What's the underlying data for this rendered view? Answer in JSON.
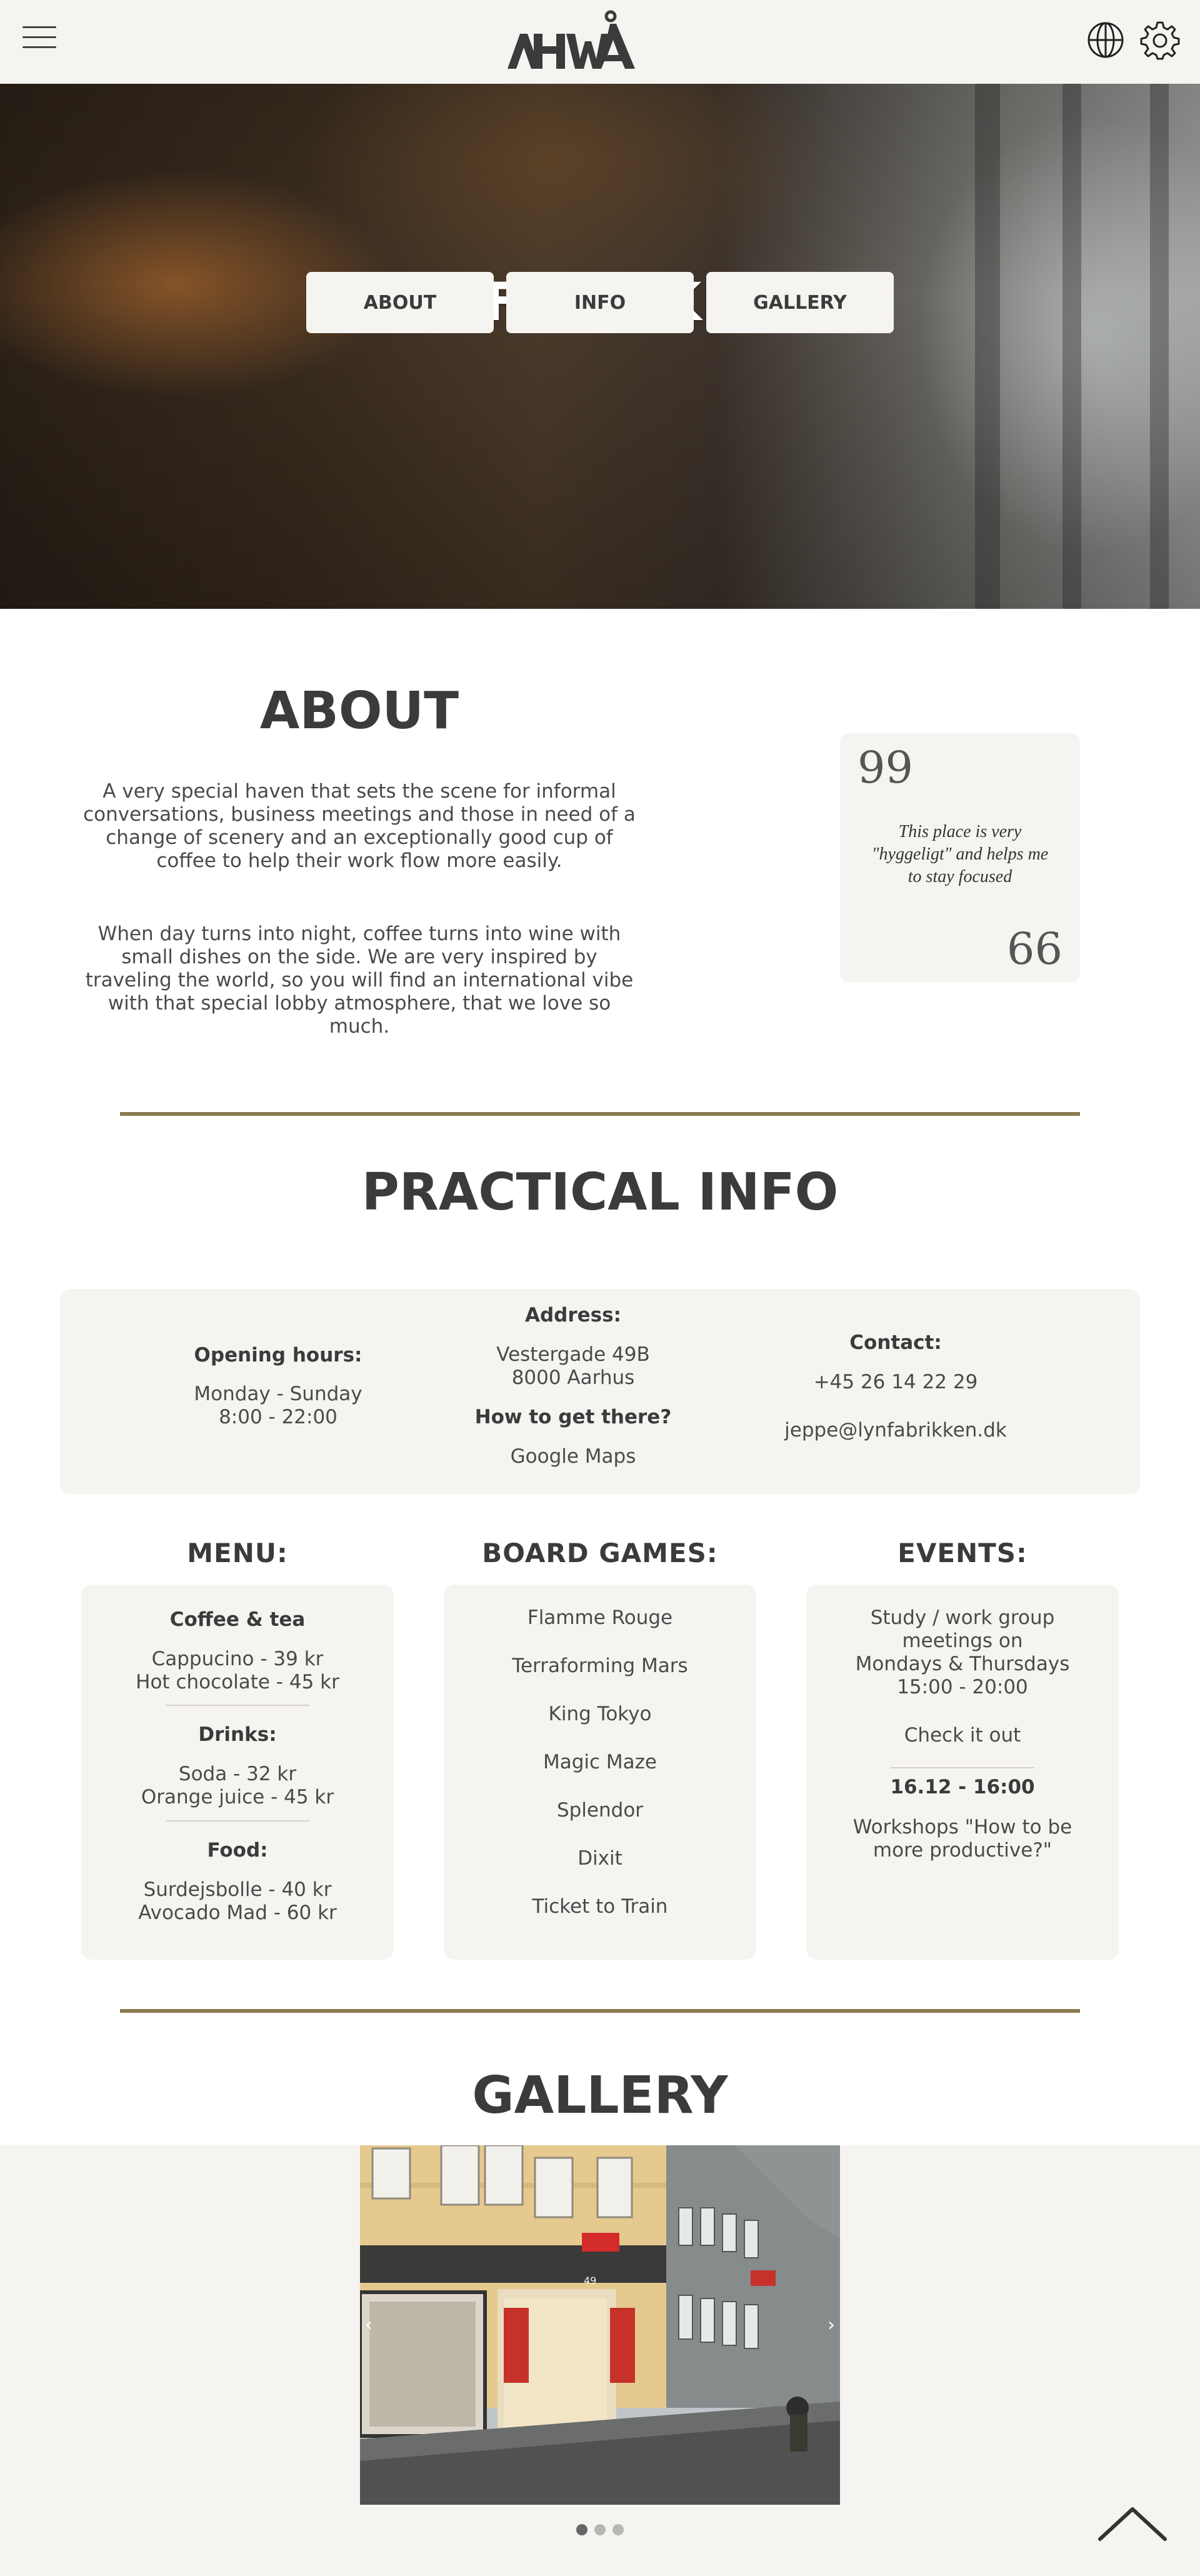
{
  "header": {
    "menu_icon": "hamburger-icon",
    "logo_text": "HWÅ",
    "icons": [
      "globe-icon",
      "gear-icon"
    ]
  },
  "hero": {
    "title": "LYNFABRIKKEN",
    "nav": [
      "ABOUT",
      "INFO",
      "GALLERY"
    ]
  },
  "about": {
    "title": "ABOUT",
    "paragraph1": "A very special haven that sets the scene for informal conversations, business meetings and those in need of a change of scenery and an exceptionally good cup of coffee to help their work flow more easily.",
    "paragraph2": "When day turns into night, coffee turns into wine with small dishes on the side. We are very inspired by traveling the world, so you will find an international vibe with that special lobby atmosphere, that we love so much.",
    "quote": {
      "open_mark": "99",
      "close_mark": "66",
      "text": "This place is very \"hyggeligt\" and helps me to stay focused"
    }
  },
  "practical_info": {
    "title": "PRACTICAL INFO",
    "opening_hours_label": "Opening hours:",
    "opening_days": "Monday - Sunday",
    "opening_time": "8:00 - 22:00",
    "address_label": "Address:",
    "address_line1": "Vestergade 49B",
    "address_line2": "8000 Aarhus",
    "directions_label": "How to get there?",
    "directions_link": "Google Maps",
    "contact_label": "Contact:",
    "phone": "+45 26 14 22 29",
    "email": "jeppe@lynfabrikken.dk"
  },
  "menu": {
    "heading": "MENU:",
    "sections": [
      {
        "label": "Coffee & tea",
        "items": [
          "Cappucino - 39 kr",
          "Hot chocolate - 45 kr"
        ]
      },
      {
        "label": "Drinks:",
        "items": [
          "Soda - 32 kr",
          "Orange juice - 45 kr"
        ]
      },
      {
        "label": "Food:",
        "items": [
          "Surdejsbolle - 40 kr",
          "Avocado Mad - 60 kr"
        ]
      }
    ]
  },
  "board_games": {
    "heading": "BOARD GAMES:",
    "items": [
      "Flamme Rouge",
      "Terraforming Mars",
      "King Tokyo",
      "Magic Maze",
      "Splendor",
      "Dixit",
      "Ticket to Train"
    ]
  },
  "events": {
    "heading": "EVENTS:",
    "event1_line1": "Study / work group",
    "event1_line2": "meetings on",
    "event1_line3": "Mondays & Thursdays",
    "event1_line4": "15:00 - 20:00",
    "event1_link": "Check it out",
    "event2_date": "16.12 - 16:00",
    "event2_line1": "Workshops \"How to be",
    "event2_line2": "more productive?\""
  },
  "gallery": {
    "title": "GALLERY",
    "prev_icon": "chevron-left-icon",
    "next_icon": "chevron-right-icon",
    "building_number": "49",
    "active_slide": 1,
    "slide_count": 3,
    "back_to_top_icon": "chevron-up-icon"
  },
  "colors": {
    "background_light": "#f5f4f1",
    "text_dark": "#3b3b3b",
    "divider": "#8a7a4f",
    "dot_active": "#666666",
    "dot_inactive": "#b8b6b1"
  }
}
